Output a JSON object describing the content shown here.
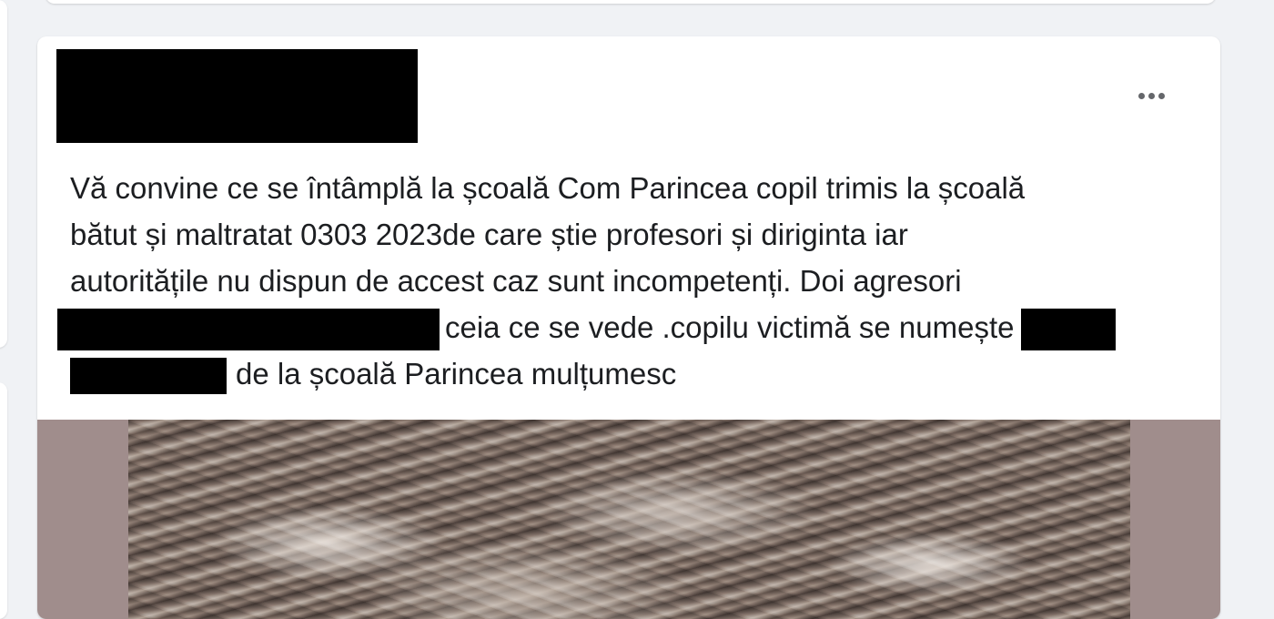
{
  "post": {
    "more_icon": "more-horizontal-icon",
    "text_lines": [
      "Vă convine ce se întâmplă la școală Com Parincea copil trimis la școală",
      "bătut și maltratat 0303 2023de care știe profesori și diriginta iar",
      "autoritățile nu dispun de accest caz sunt incompetenți. Doi agresori",
      "ceia ce se vede .copilu victimă se numește",
      "de la școală Parincea mulțumesc"
    ],
    "image_icon": "post-photo"
  },
  "colors": {
    "background": "#f0f2f5",
    "card": "#ffffff",
    "text": "#1c1e21",
    "icon": "#65676b",
    "redaction": "#000000",
    "media_bg": "#a08d8c"
  }
}
